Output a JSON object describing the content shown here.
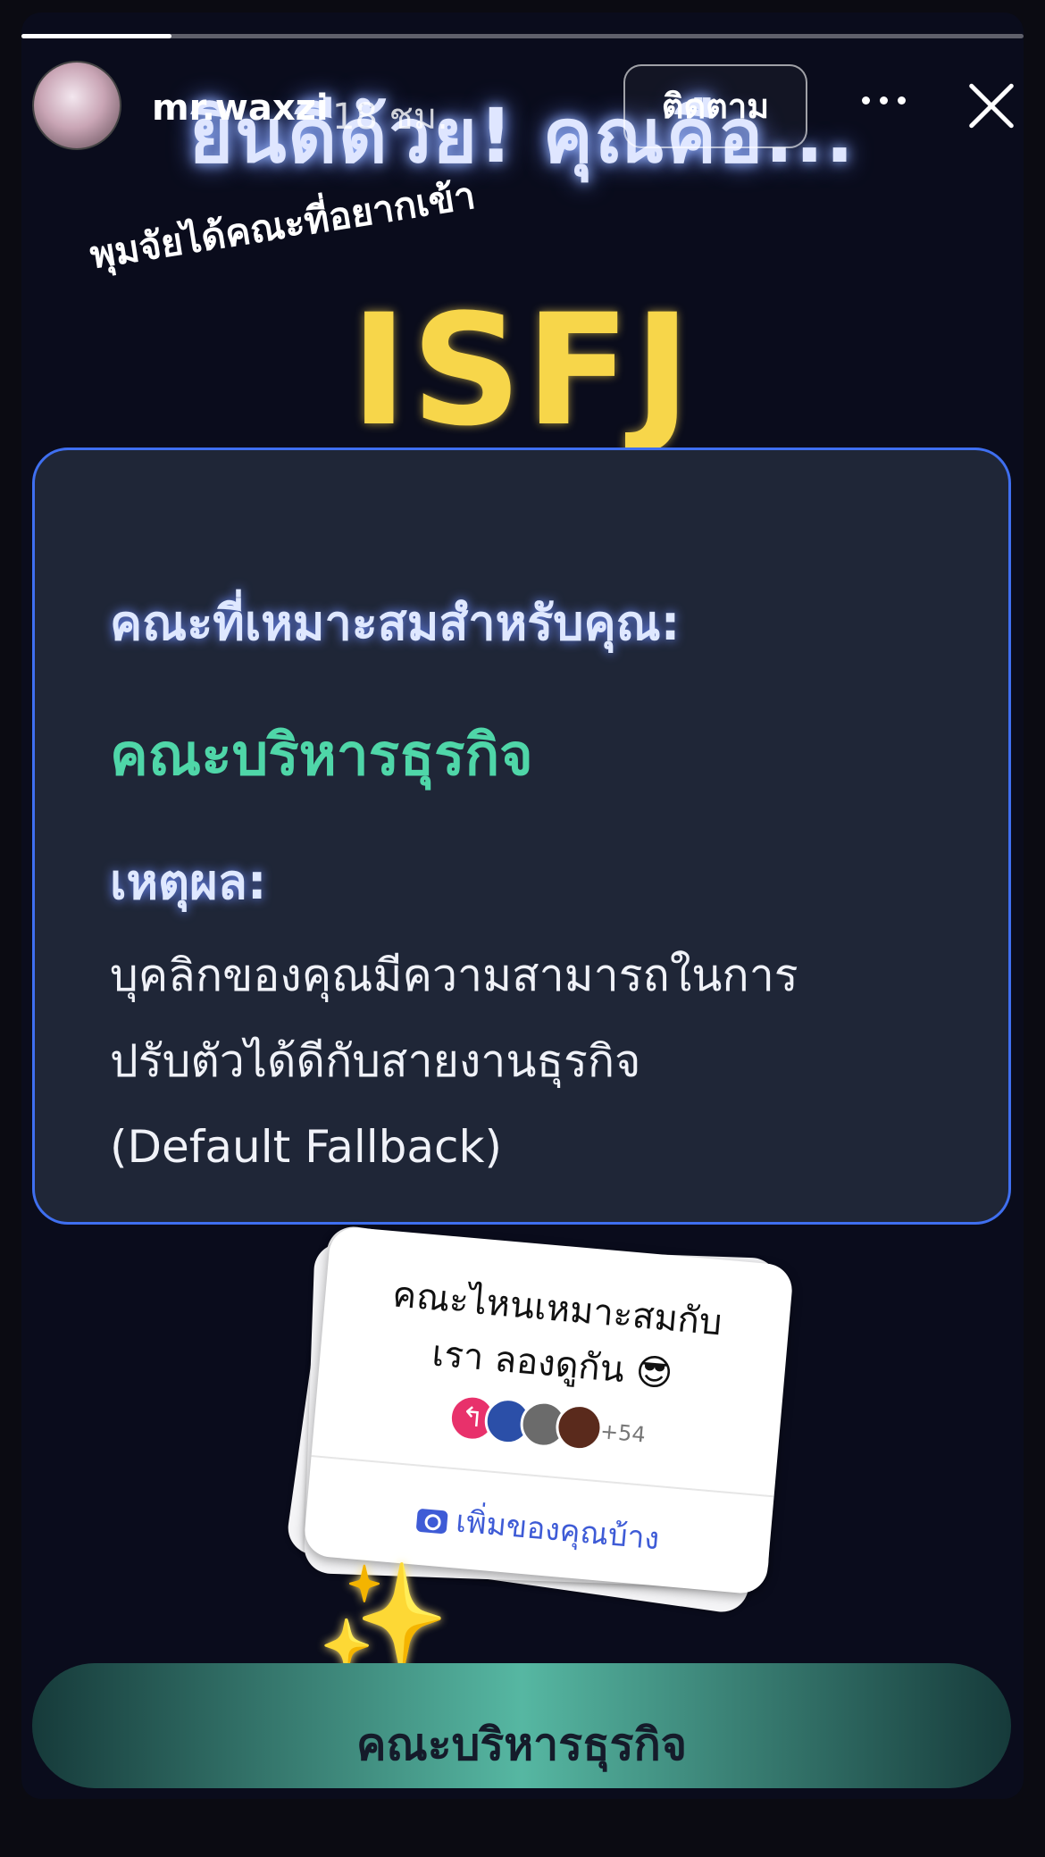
{
  "story": {
    "progress": 0.15,
    "headline": "ยินดีด้วย! คุณคือ...",
    "subtitle": "พุมจัยได้คณะที่อยากเข้า",
    "mbti": "ISFJ"
  },
  "header": {
    "username": "mr.waxzi",
    "time": "18 ชม.",
    "follow_label": "ติดตาม",
    "more_icon": "more-horizontal-icon",
    "close_icon": "close-icon"
  },
  "result_card": {
    "heading": "คณะที่เหมาะสมสำหรับคุณ:",
    "faculty": "คณะบริหารธุรกิจ",
    "reason_label": "เหตุผล:",
    "reason_lines": [
      "บุคลิกของคุณมีความสามารถในการ",
      "ปรับตัวได้ดีกับสายงานธุรกิจ",
      "(Default Fallback)"
    ]
  },
  "sticker": {
    "line1": "คณะไหนเหมาะสมกับ",
    "line2": "เรา ลองดูกัน 😎",
    "participant_count": "+54",
    "action_label": "เพิ่มของคุณบ้าง",
    "action_icon": "camera-icon"
  },
  "decoration": {
    "sparkles": "✨"
  },
  "bottom_button": {
    "label": "คณะบริหารธุรกิจ"
  },
  "colors": {
    "faculty_green": "#4fd6a8",
    "mbti_yellow": "#f7d64a",
    "card_border": "#3f6ff0",
    "reply_badge": "#e8316b",
    "link_blue": "#3e5bd6"
  }
}
